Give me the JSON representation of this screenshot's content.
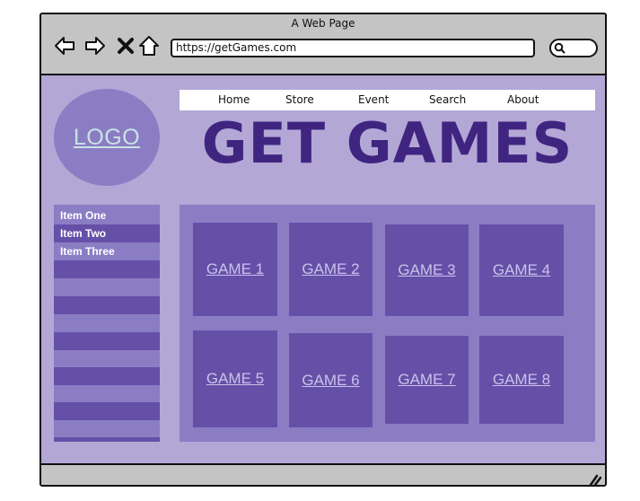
{
  "window": {
    "title": "A Web Page",
    "url": "https://getGames.com"
  },
  "icons": {
    "back": "back-arrow-icon",
    "forward": "forward-arrow-icon",
    "stop": "close-icon",
    "home": "home-icon",
    "search": "search-icon",
    "resize": "resize-grip-icon"
  },
  "logo": {
    "label": "LOGO"
  },
  "nav": {
    "items": [
      "Home",
      "Store",
      "Event",
      "Search",
      "About"
    ]
  },
  "hero": {
    "title": "GET GAMES"
  },
  "sidebar": {
    "items": [
      "Item One",
      "Item Two",
      "Item Three"
    ]
  },
  "games": [
    "GAME 1",
    "GAME 2",
    "GAME 3",
    "GAME 4",
    "GAME 5",
    "GAME 6",
    "GAME 7",
    "GAME 8"
  ],
  "colors": {
    "page_bg": "#b3a7d6",
    "panel": "#8b7dc4",
    "tile": "#6550a8",
    "hero_text": "#3f2580",
    "chrome": "#c4c4c4"
  }
}
